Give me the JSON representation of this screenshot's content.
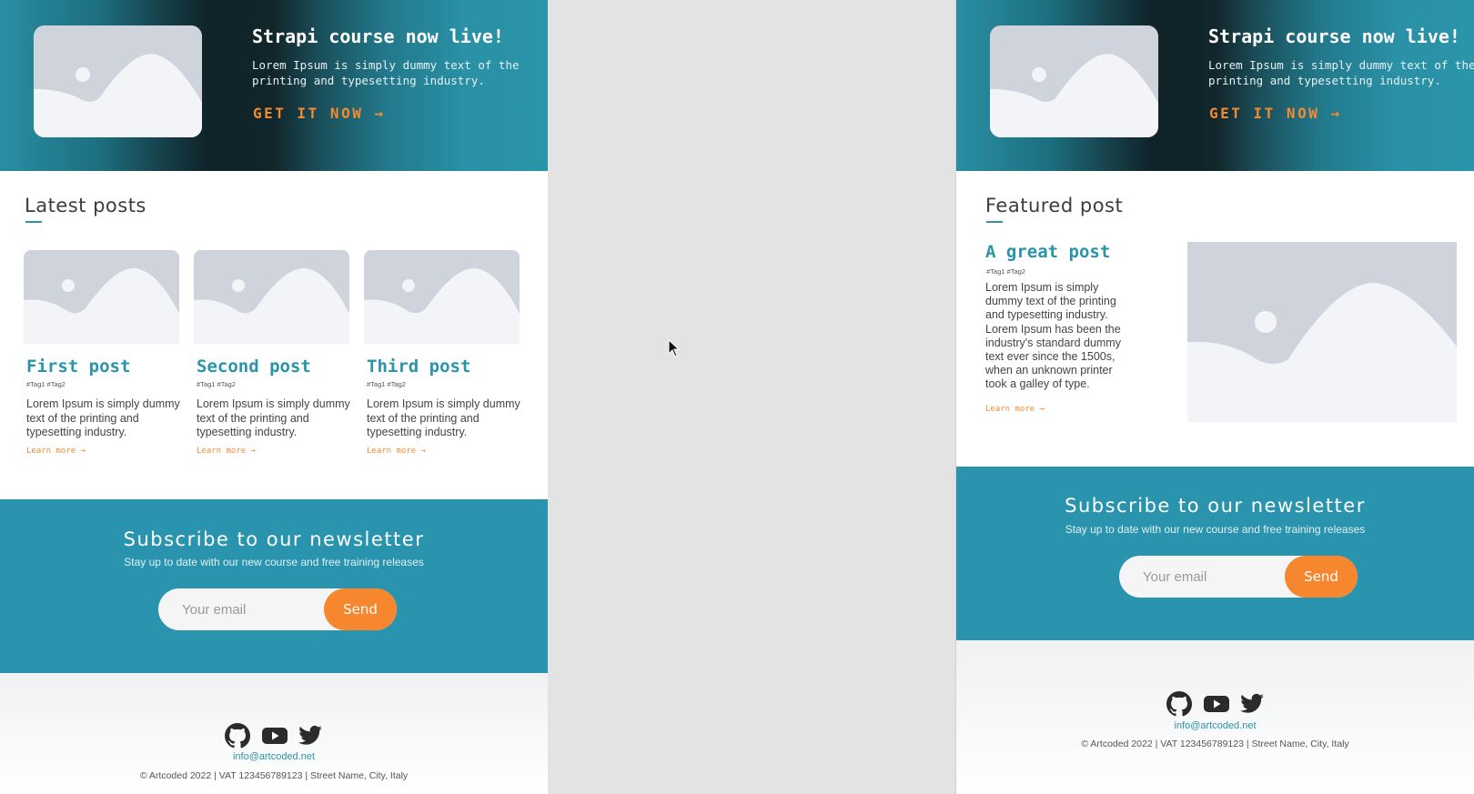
{
  "hero": {
    "title": "Strapi course now live!",
    "subtitle": "Lorem Ipsum is simply dummy text of the printing and typesetting industry.",
    "cta": "GET IT NOW →"
  },
  "latest": {
    "heading": "Latest posts",
    "posts": [
      {
        "title": "First post",
        "tags": "#Tag1  #Tag2",
        "text": "Lorem Ipsum is simply dummy text of the printing and typesetting industry.",
        "link": "Learn more →"
      },
      {
        "title": "Second post",
        "tags": "#Tag1  #Tag2",
        "text": "Lorem Ipsum is simply dummy text of the printing and typesetting industry.",
        "link": "Learn more →"
      },
      {
        "title": "Third post",
        "tags": "#Tag1  #Tag2",
        "text": "Lorem Ipsum is simply dummy text of the printing and typesetting industry.",
        "link": "Learn more →"
      }
    ]
  },
  "featured": {
    "heading": "Featured post",
    "title": "A great post",
    "tags": "#Tag1  #Tag2",
    "text": "Lorem Ipsum is simply dummy text of the printing and typesetting industry. Lorem Ipsum has been the industry's standard dummy text ever since the 1500s, when an unknown printer took a galley of type.",
    "link": "Learn more →"
  },
  "newsletter": {
    "title": "Subscribe to our newsletter",
    "subtitle": "Stay up to date with our new course and free training releases",
    "placeholder": "Your email",
    "button": "Send"
  },
  "footer": {
    "icons": [
      "github-icon",
      "youtube-icon",
      "twitter-icon"
    ],
    "email": "info@artcoded.net",
    "copyright": "© Artcoded 2022  |  VAT 123456789123 |  Street Name, City, Italy"
  },
  "colors": {
    "accent": "#2a94a8",
    "cta": "#f28a30",
    "newsletter_bg": "#2a94ae",
    "placeholder_img": "#cfd3dc"
  }
}
